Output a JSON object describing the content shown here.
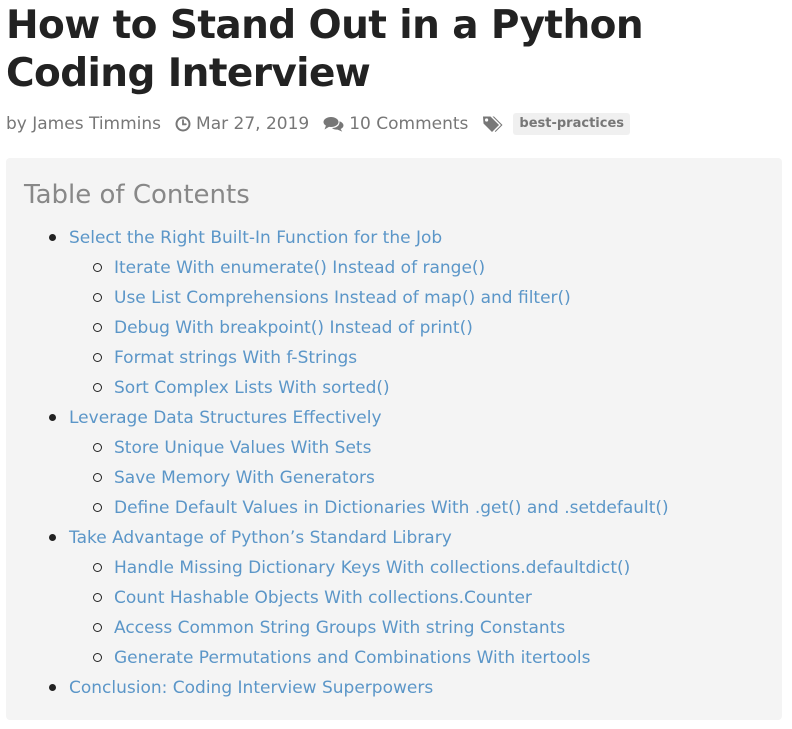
{
  "article": {
    "title": "How to Stand Out in a Python Coding Interview"
  },
  "meta": {
    "author": "by James Timmins",
    "date": "Mar 27, 2019",
    "comments": "10 Comments",
    "tag": "best-practices",
    "icons": {
      "date": "clock-icon",
      "comments": "comments-icon",
      "tags": "tags-icon"
    }
  },
  "colors": {
    "link": "#5b96c8",
    "meta_text": "#777777",
    "toc_background": "#f4f4f4",
    "title_text": "#222222",
    "toc_heading": "#888888"
  },
  "toc": {
    "heading": "Table of Contents",
    "sections": [
      {
        "label": "Select the Right Built-In Function for the Job",
        "children": [
          "Iterate With enumerate() Instead of range()",
          "Use List Comprehensions Instead of map() and filter()",
          "Debug With breakpoint() Instead of print()",
          "Format strings With f-Strings",
          "Sort Complex Lists With sorted()"
        ]
      },
      {
        "label": "Leverage Data Structures Effectively",
        "children": [
          "Store Unique Values With Sets",
          "Save Memory With Generators",
          "Define Default Values in Dictionaries With .get() and .setdefault()"
        ]
      },
      {
        "label": "Take Advantage of Python’s Standard Library",
        "children": [
          "Handle Missing Dictionary Keys With collections.defaultdict()",
          "Count Hashable Objects With collections.Counter",
          "Access Common String Groups With string Constants",
          "Generate Permutations and Combinations With itertools"
        ]
      },
      {
        "label": "Conclusion: Coding Interview Superpowers",
        "children": []
      }
    ]
  }
}
